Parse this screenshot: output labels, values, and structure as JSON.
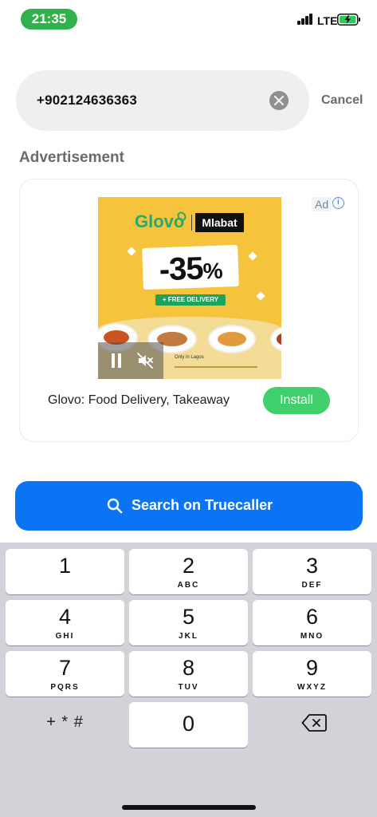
{
  "status_bar": {
    "time": "21:35",
    "network": "LTE",
    "signal_icon": "cellular-signal-icon",
    "battery_icon": "battery-charging-icon",
    "time_pill_color": "#2fb24c"
  },
  "search": {
    "value": "+902124636363",
    "clear_icon": "clear-circle-icon",
    "cancel_label": "Cancel"
  },
  "advertisement": {
    "heading": "Advertisement",
    "ad_badge": "Ad",
    "info_icon": "info-icon",
    "banner": {
      "brand_primary": "Glovo",
      "brand_secondary": "Mlabat",
      "discount_value": "-35",
      "discount_unit": "%",
      "tagline": "+ FREE DELIVERY",
      "location_note": "Only in Lagos"
    },
    "video_controls": {
      "pause_icon": "pause-icon",
      "mute_icon": "speaker-muted-icon"
    },
    "app_name": "Glovo: Food Delivery, Takeaway",
    "install_label": "Install",
    "install_color": "#3fcf6c"
  },
  "search_button": {
    "label": "Search on Truecaller",
    "icon": "search-icon",
    "color": "#0a74f5"
  },
  "keypad": {
    "keys": [
      {
        "digit": "1",
        "letters": ""
      },
      {
        "digit": "2",
        "letters": "ABC"
      },
      {
        "digit": "3",
        "letters": "DEF"
      },
      {
        "digit": "4",
        "letters": "GHI"
      },
      {
        "digit": "5",
        "letters": "JKL"
      },
      {
        "digit": "6",
        "letters": "MNO"
      },
      {
        "digit": "7",
        "letters": "PQRS"
      },
      {
        "digit": "8",
        "letters": "TUV"
      },
      {
        "digit": "9",
        "letters": "WXYZ"
      },
      {
        "digit": "0",
        "letters": ""
      }
    ],
    "symbols_label": "+ * #",
    "delete_icon": "backspace-icon"
  }
}
